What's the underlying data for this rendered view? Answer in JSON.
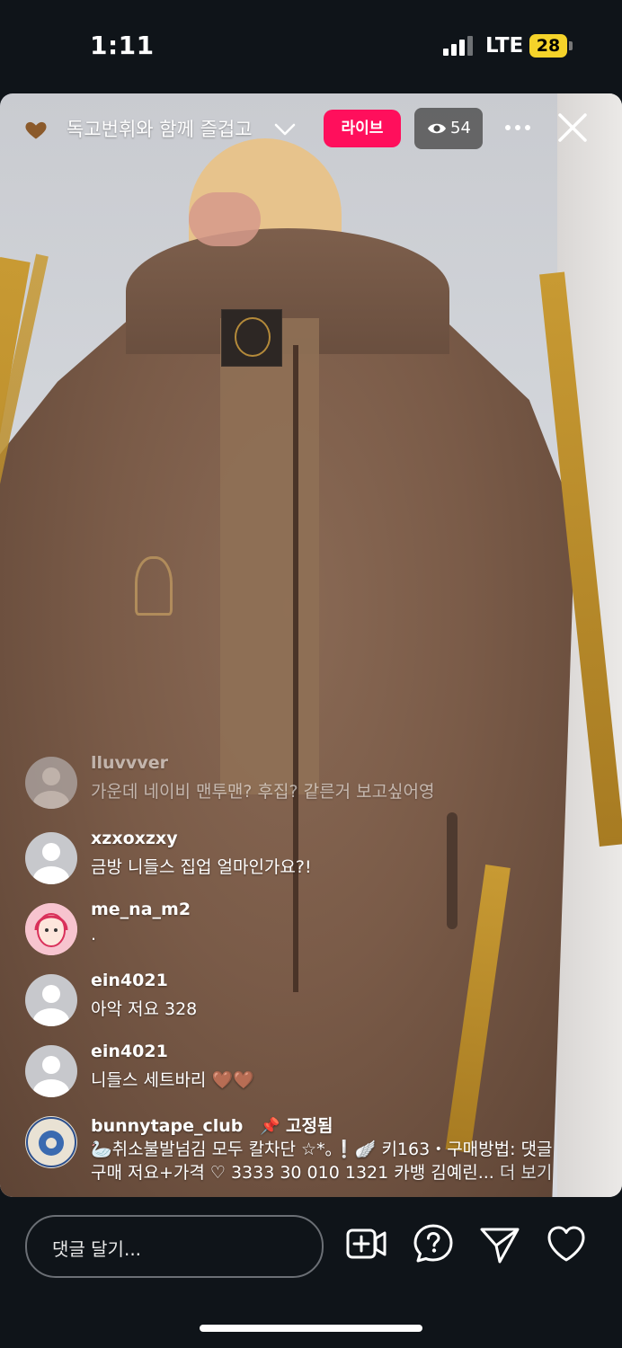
{
  "status_bar": {
    "time": "1:11",
    "network": "LTE",
    "battery": "28"
  },
  "header": {
    "title": "독고번휘와 함께 즐겁고",
    "live_label": "라이브",
    "viewer_count": "54"
  },
  "comments": [
    {
      "user": "lluvvver",
      "text": "가운데 네이비 맨투맨? 후집? 같른거 보고싶어영",
      "faded": true
    },
    {
      "user": "xzxoxzxy",
      "text": "금방 니들스 집업 얼마인가요?!"
    },
    {
      "user": "me_na_m2",
      "text": "."
    },
    {
      "user": "ein4021",
      "text": "아악 저요 328"
    },
    {
      "user": "ein4021",
      "text": "니들스 세트바리 🤎🤎"
    },
    {
      "user": "bunnytape_club",
      "pinned_label": "고정됨",
      "text_line1": "🦢취소불발넘김 모두 칼차단 ☆*｡❕🪽 키163・구매방법: 댓글",
      "text_line2": "구매 저요+가격 ♡ 3333 30 010 1321 카뱅 김예린...",
      "more": "더 보기"
    }
  ],
  "bottom_bar": {
    "comment_placeholder": "댓글 달기..."
  },
  "colors": {
    "live": "#ff0f5c",
    "background": "#0f1419",
    "battery": "#f5d32a"
  }
}
